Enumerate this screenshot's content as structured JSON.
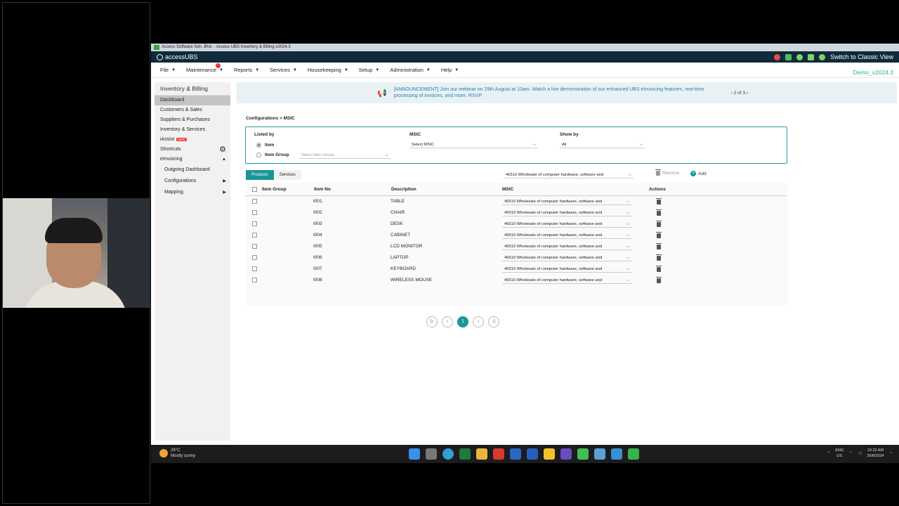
{
  "window_title": "Access Software Sdn. Bhd. - Access UBS Inventory & Billing v2024.3",
  "brand": "accessUBS",
  "switch_view": "Switch to Classic View",
  "demo_label": "Demo_v2024.3",
  "menu": [
    "File",
    "Maintenance",
    "Reports",
    "Services",
    "Housekeeping",
    "Setup",
    "Administration",
    "Help"
  ],
  "sidebar": {
    "title": "Inventory & Billing",
    "items": [
      "Dashboard",
      "Customers & Sales",
      "Suppliers & Purchases",
      "Inventory & Services",
      "iAssist",
      "Shortcuts",
      "eInvoicing"
    ],
    "new_badge": "NEW",
    "sub_items": [
      "Outgoing Dashboard",
      "Configurations",
      "Mapping"
    ]
  },
  "announcement": {
    "text": "[ANNOUNCEMENT] Join our webinar on 29th August at 10am. Watch a live demonstration of our enhanced UBS eInvoicing features, real-time processing of invoices, and more. RSVP.",
    "page": "2 of 3"
  },
  "breadcrumb": "Configurations > MSIC",
  "filter": {
    "listed_by_label": "Listed by",
    "option_item": "Item",
    "option_item_group": "Item Group",
    "item_group_placeholder": "Select Item Group",
    "msic_label": "MSIC",
    "msic_select": "Select MSIC",
    "show_by_label": "Show by",
    "show_by_value": "All"
  },
  "tabs": [
    "Products",
    "Services"
  ],
  "bulk_msic": "46510 Wholesale of computer hardware, software and",
  "remove_label": "Remove",
  "add_label": "Add",
  "table": {
    "headers": [
      "Item Group",
      "Item No",
      "Description",
      "MSIC",
      "Actions"
    ],
    "rows": [
      {
        "item_no": "I001",
        "description": "TABLE",
        "msic": "46510 Wholesale of computer hardware, software and"
      },
      {
        "item_no": "I002",
        "description": "CHAIR",
        "msic": "46510 Wholesale of computer hardware, software and"
      },
      {
        "item_no": "I003",
        "description": "DESK",
        "msic": "46510 Wholesale of computer hardware, software and"
      },
      {
        "item_no": "I004",
        "description": "CABINET",
        "msic": "46510 Wholesale of computer hardware, software and"
      },
      {
        "item_no": "I005",
        "description": "LCD MONITOR",
        "msic": "46510 Wholesale of computer hardware, software and"
      },
      {
        "item_no": "I006",
        "description": "LAPTOP",
        "msic": "46510 Wholesale of computer hardware, software and"
      },
      {
        "item_no": "I007",
        "description": "KEYBOARD",
        "msic": "46510 Wholesale of computer hardware, software and"
      },
      {
        "item_no": "I008",
        "description": "WIRELESS MOUSE",
        "msic": "46510 Wholesale of computer hardware, software and"
      }
    ]
  },
  "pager": {
    "current": "1"
  },
  "taskbar": {
    "temperature": "28°C",
    "weather": "Mostly sunny",
    "lang1": "ENG",
    "lang2": "US",
    "time": "10:22 AM",
    "date": "29/8/2024"
  },
  "colors": {
    "accent": "#1a9696",
    "brand_bar": "#0f2a3a",
    "demo": "#2bb673"
  }
}
